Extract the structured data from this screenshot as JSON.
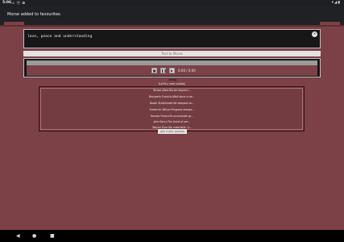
{
  "status_bar": {
    "time": "5:06",
    "glyphs": "⚠ ⓟ ✿",
    "system_icons": "▾◢▮"
  },
  "toast": {
    "message": "Morse added to favourites."
  },
  "input": {
    "value": "love, peace and understanding"
  },
  "convert_button": {
    "label": "Text to Morse"
  },
  "player": {
    "counter": "0:00 / 0:00",
    "label": "beep"
  },
  "quotes": [
    "&#39;s note (saikat)",
    "Teresa (Bad-Die.be stayed-I...",
    "Benjamin Franklin:Well done is be...",
    "Booth Brathheath:Be deepest se...",
    "Frederick Wilson:Progress always...",
    "Honore Faraca:To accomplish gr...",
    "John Berry:The thirst of per...",
    "Wayne Dyer:Be miserable. O..."
  ],
  "more_button": {
    "label": "get more quotes"
  },
  "nav": {
    "back": "◀",
    "home": "●",
    "recents": "■"
  },
  "colors": {
    "app_bg": "#7b4146",
    "dark_panel": "#171717",
    "toast_bg": "#1f2124"
  }
}
